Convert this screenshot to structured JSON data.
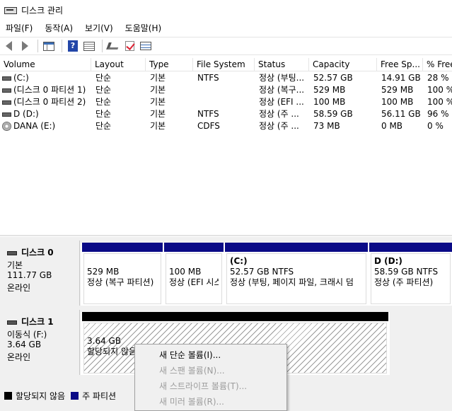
{
  "window": {
    "title": "디스크 관리",
    "icon": "disk-management-icon"
  },
  "menu": [
    "파일(F)",
    "동작(A)",
    "보기(V)",
    "도움말(H)"
  ],
  "toolbar_icons": [
    "back-arrow-icon",
    "forward-arrow-icon",
    "console-tree-icon",
    "help-icon",
    "list-view-icon",
    "connect-icon",
    "check-icon",
    "properties-icon"
  ],
  "table": {
    "columns": [
      "Volume",
      "Layout",
      "Type",
      "File System",
      "Status",
      "Capacity",
      "Free Sp...",
      "% Free"
    ],
    "rows": [
      {
        "icon": "volume-icon",
        "volume": "(C:)",
        "layout": "단순",
        "type": "기본",
        "fs": "NTFS",
        "status": "정상 (부팅...",
        "capacity": "52.57 GB",
        "free": "14.91 GB",
        "pct": "28 %"
      },
      {
        "icon": "volume-icon",
        "volume": "(디스크 0 파티션 1)",
        "layout": "단순",
        "type": "기본",
        "fs": "",
        "status": "정상 (복구...",
        "capacity": "529 MB",
        "free": "529 MB",
        "pct": "100 %"
      },
      {
        "icon": "volume-icon",
        "volume": "(디스크 0 파티션 2)",
        "layout": "단순",
        "type": "기본",
        "fs": "",
        "status": "정상 (EFI ...",
        "capacity": "100 MB",
        "free": "100 MB",
        "pct": "100 %"
      },
      {
        "icon": "volume-icon",
        "volume": "D (D:)",
        "layout": "단순",
        "type": "기본",
        "fs": "NTFS",
        "status": "정상 (주 ...",
        "capacity": "58.59 GB",
        "free": "56.11 GB",
        "pct": "96 %"
      },
      {
        "icon": "cd-drive-icon",
        "volume": "DANA (E:)",
        "layout": "단순",
        "type": "기본",
        "fs": "CDFS",
        "status": "정상 (주 ...",
        "capacity": "73 MB",
        "free": "0 MB",
        "pct": "0 %"
      }
    ]
  },
  "disks": [
    {
      "name": "디스크 0",
      "kind": "기본",
      "size": "111.77 GB",
      "state": "온라인",
      "partitions": [
        {
          "title": "",
          "line1": "529 MB",
          "line2": "정상 (복구 파티션)"
        },
        {
          "title": "",
          "line1": "100 MB",
          "line2": "정상 (EFI 시스"
        },
        {
          "title": "(C:)",
          "line1": "52.57 GB NTFS",
          "line2": "정상 (부팅, 페이지 파일, 크래시 덤"
        },
        {
          "title": "D  (D:)",
          "line1": "58.59 GB NTFS",
          "line2": "정상 (주 파티션)"
        }
      ]
    },
    {
      "name": "디스크 1",
      "kind": "이동식 (F:)",
      "size": "3.64 GB",
      "state": "온라인",
      "partitions": [
        {
          "title": "",
          "line1": "3.64 GB",
          "line2": "할당되지 않음"
        }
      ]
    }
  ],
  "legend": [
    {
      "label": "할당되지 않음",
      "color": "#000000"
    },
    {
      "label": "주 파티션",
      "color": "#0a0a86"
    }
  ],
  "context_menu": [
    {
      "label": "새 단순 볼륨(I)...",
      "enabled": true
    },
    {
      "label": "새 스팬 볼륨(N)...",
      "enabled": false
    },
    {
      "label": "새 스트라이프 볼륨(T)...",
      "enabled": false
    },
    {
      "label": "새 미러 볼륨(R)...",
      "enabled": false
    }
  ]
}
